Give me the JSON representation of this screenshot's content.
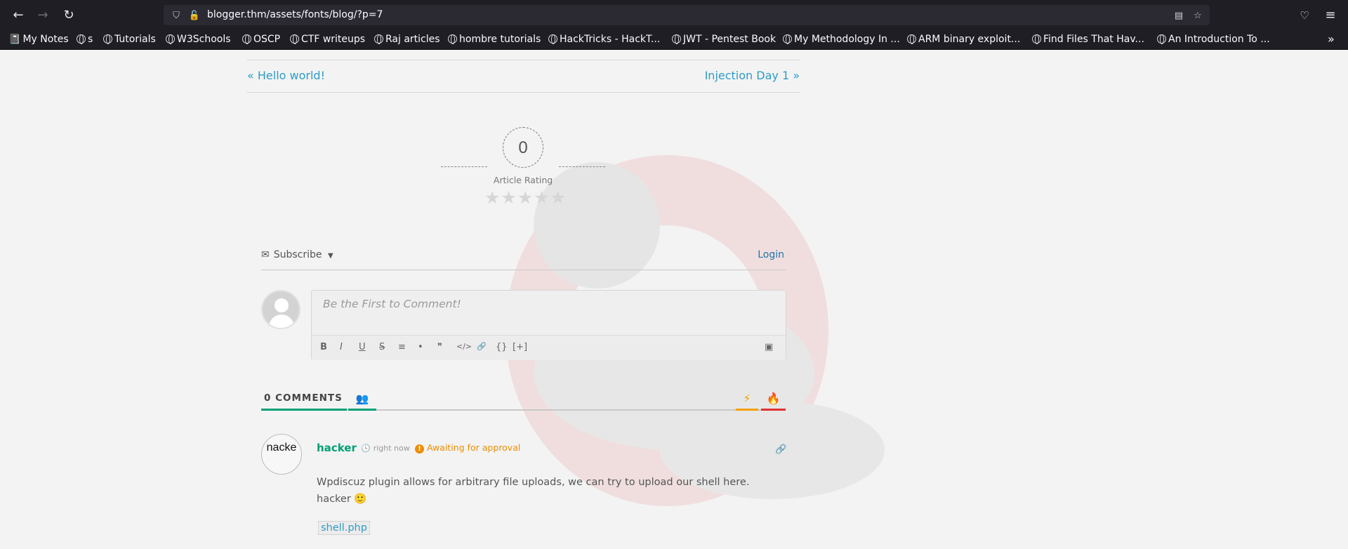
{
  "browser": {
    "url": "blogger.thm/assets/fonts/blog/?p=7",
    "bookmarks": [
      "My Notes",
      "s",
      "Tutorials",
      "W3Schools",
      "OSCP",
      "CTF writeups",
      "Raj articles",
      "hombre tutorials",
      "HackTricks - HackT...",
      "JWT - Pentest Book",
      "My Methodology In ...",
      "ARM binary exploit...",
      "Find Files That Hav...",
      "An Introduction To ..."
    ]
  },
  "post_nav": {
    "prev": "« Hello world!",
    "next": "Injection Day 1 »"
  },
  "rating": {
    "value": "0",
    "label": "Article Rating",
    "stars": "★★★★★"
  },
  "comments_form": {
    "subscribe_label": "Subscribe",
    "login_label": "Login",
    "placeholder": "Be the First to Comment!",
    "toolbar": [
      "B",
      "I",
      "U",
      "S",
      "≡",
      "•",
      "❞",
      "</>",
      "🔗",
      "{}",
      "[+]"
    ]
  },
  "tabs": {
    "comments_label": "0 COMMENTS"
  },
  "comment": {
    "avatar_text": "nacke",
    "author": "hacker",
    "time": "right now",
    "status": "Awaiting for approval",
    "text_line1": "Wpdiscuz plugin allows for arbitrary file uploads, we can try to upload our shell here.",
    "text_line2": "hacker 🙂",
    "file": "shell.php"
  }
}
